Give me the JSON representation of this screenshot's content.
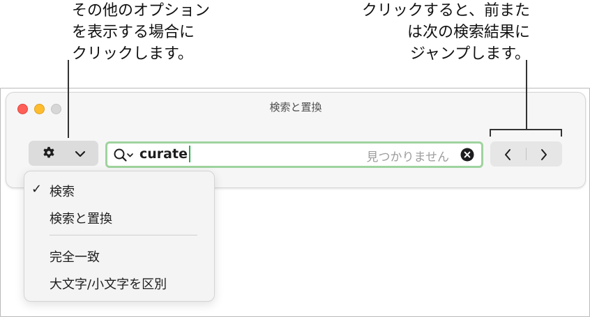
{
  "callouts": {
    "left": "その他のオプション\nを表示する場合に\nクリックします。",
    "right": "クリックすると、前また\nは次の検索結果に\nジャンプします。"
  },
  "window": {
    "title": "検索と置換"
  },
  "toolbar": {
    "options_icon": "gear-icon",
    "options_chevron": "chevron-down-icon"
  },
  "search": {
    "value": "curate",
    "status": "見つかりません",
    "icon": "magnifier-icon",
    "clear_icon": "clear-icon",
    "focus_color": "#9fd39e"
  },
  "navigation": {
    "prev_icon": "chevron-left-icon",
    "next_icon": "chevron-right-icon"
  },
  "menu": {
    "check": "✓",
    "items": [
      {
        "label": "検索",
        "checked": true
      },
      {
        "label": "検索と置換",
        "checked": false
      },
      {
        "label": "完全一致",
        "checked": false
      },
      {
        "label": "大文字/小文字を区別",
        "checked": false
      }
    ]
  },
  "colors": {
    "close": "#fe5f57",
    "minimize": "#febc2e",
    "maximize_inactive": "#d7d7d7"
  }
}
